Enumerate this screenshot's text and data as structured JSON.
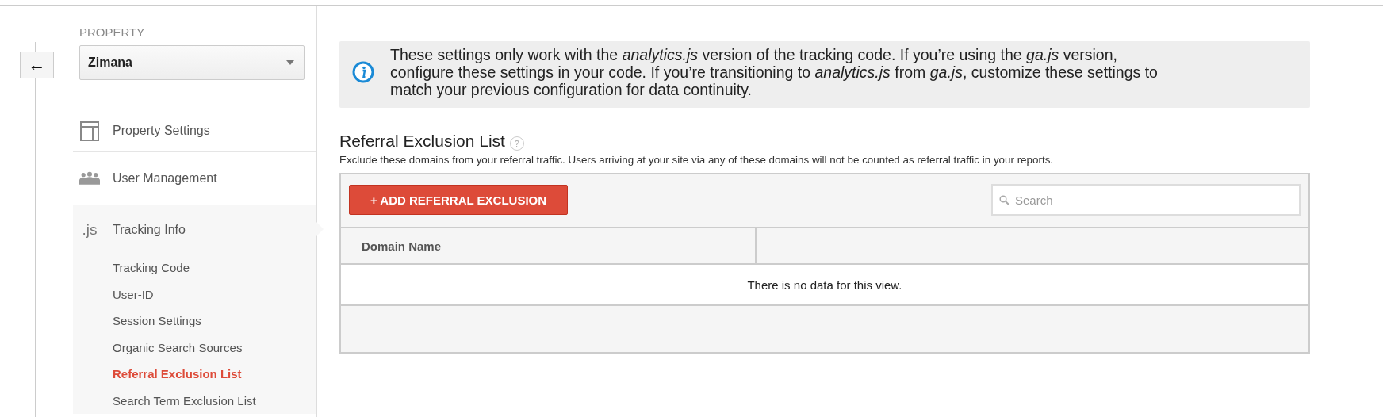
{
  "sidebar": {
    "back_button": "←",
    "property_label": "PROPERTY",
    "property_select": "Zimana",
    "items": [
      {
        "kind": "settings",
        "label": "Property Settings",
        "selected": false
      },
      {
        "kind": "users",
        "label": "User Management",
        "selected": false
      },
      {
        "kind": "js",
        "icon_text": ".js",
        "label": "Tracking Info",
        "selected": true,
        "children": [
          {
            "label": "Tracking Code",
            "selected": false
          },
          {
            "label": "User-ID",
            "selected": false
          },
          {
            "label": "Session Settings",
            "selected": false
          },
          {
            "label": "Organic Search Sources",
            "selected": false
          },
          {
            "label": "Referral Exclusion List",
            "selected": true
          },
          {
            "label": "Search Term Exclusion List",
            "selected": false
          }
        ]
      }
    ]
  },
  "notice": "These settings only work with the *analytics.js* version of the tracking code. If you’re using the *ga.js* version, configure these settings in your code. If you’re transitioning to *analytics.js* from *ga.js*, customize these settings to match your previous configuration for data continuity.",
  "section": {
    "title": "Referral Exclusion List",
    "help": "?",
    "description": "Exclude these domains from your referral traffic. Users arriving at your site via any of these domains will not be counted as referral traffic in your reports."
  },
  "table": {
    "add_button": "+ ADD REFERRAL EXCLUSION",
    "search": {
      "placeholder": "Search"
    },
    "columns": [
      "Domain Name"
    ],
    "empty_message": "There is no data for this view."
  }
}
